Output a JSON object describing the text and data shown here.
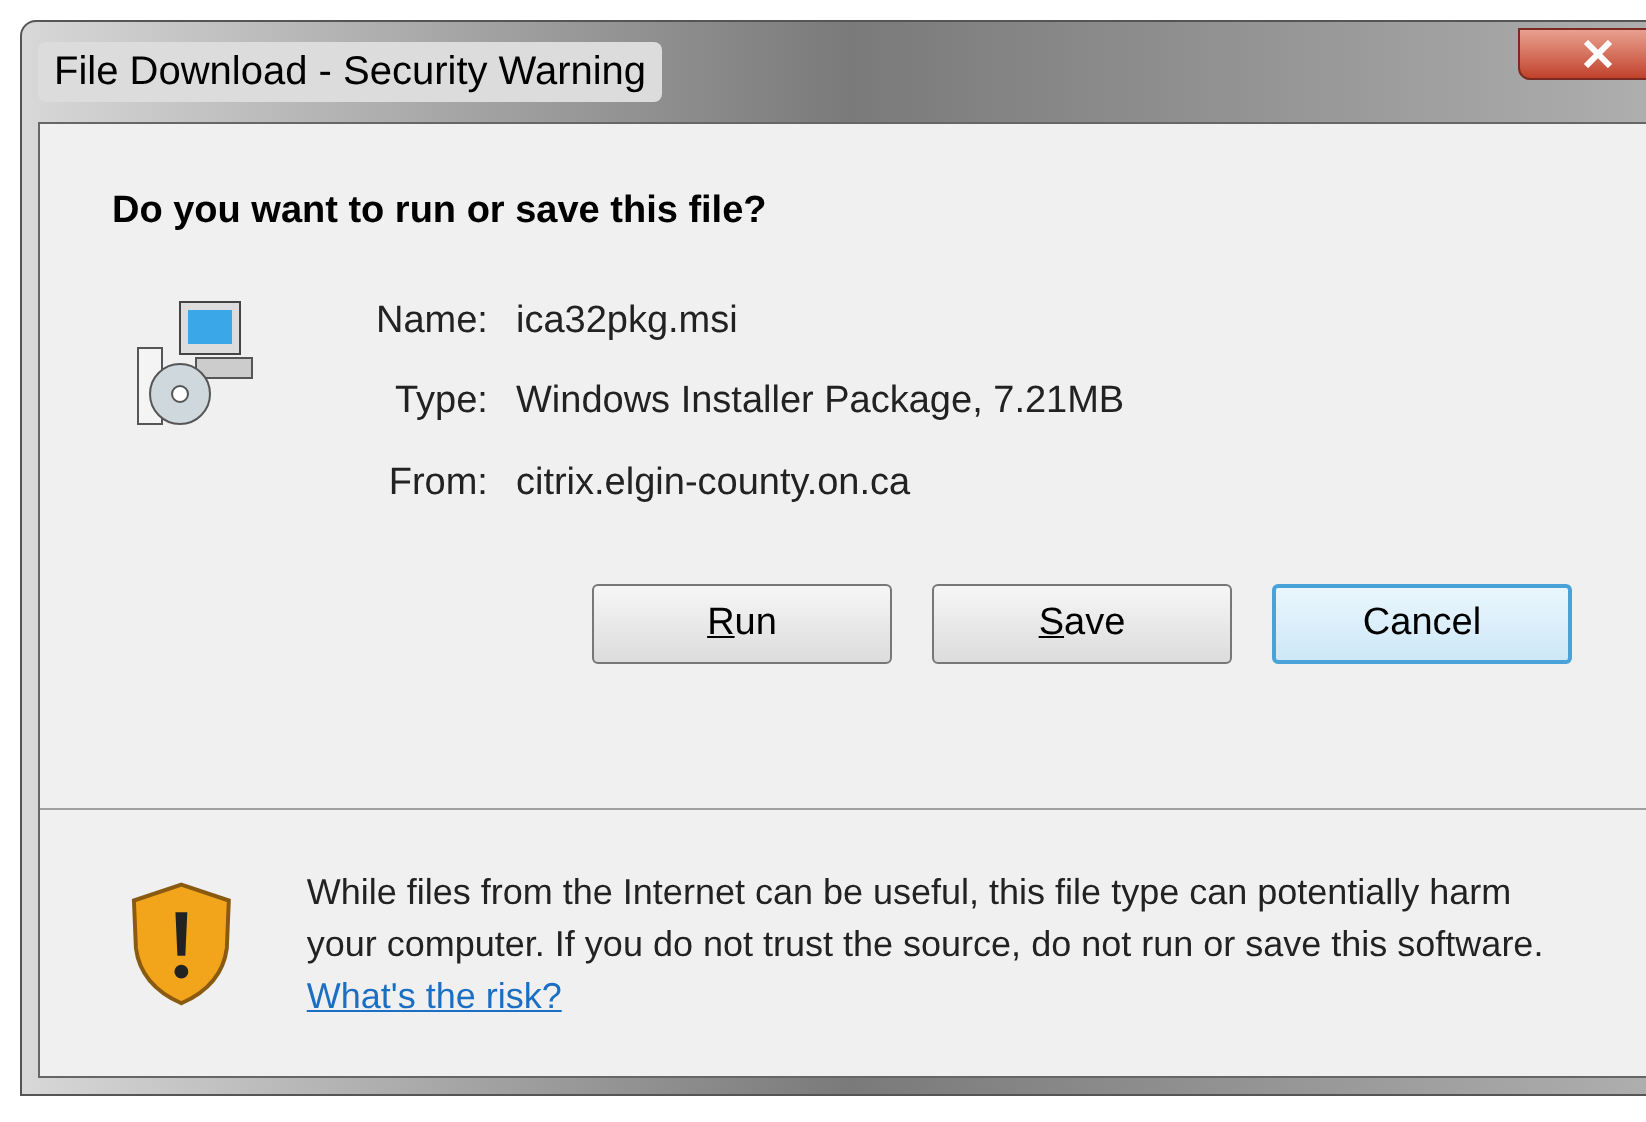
{
  "window": {
    "title": "File Download - Security Warning"
  },
  "heading": "Do you want to run or save this file?",
  "fields": [
    {
      "label": "Name:",
      "value": "ica32pkg.msi"
    },
    {
      "label": "Type:",
      "value": "Windows Installer Package, 7.21MB"
    },
    {
      "label": "From:",
      "value": "citrix.elgin-county.on.ca"
    }
  ],
  "buttons": [
    {
      "label": "Run",
      "mnemonic": true,
      "selected": false
    },
    {
      "label": "Save",
      "mnemonic": true,
      "selected": false
    },
    {
      "label": "Cancel",
      "mnemonic": false,
      "selected": true
    }
  ],
  "warning": {
    "text": "While files from the Internet can be useful, this file type can potentially harm your computer. If you do not trust the source, do not run or save this software.",
    "link": "What's the risk?"
  }
}
